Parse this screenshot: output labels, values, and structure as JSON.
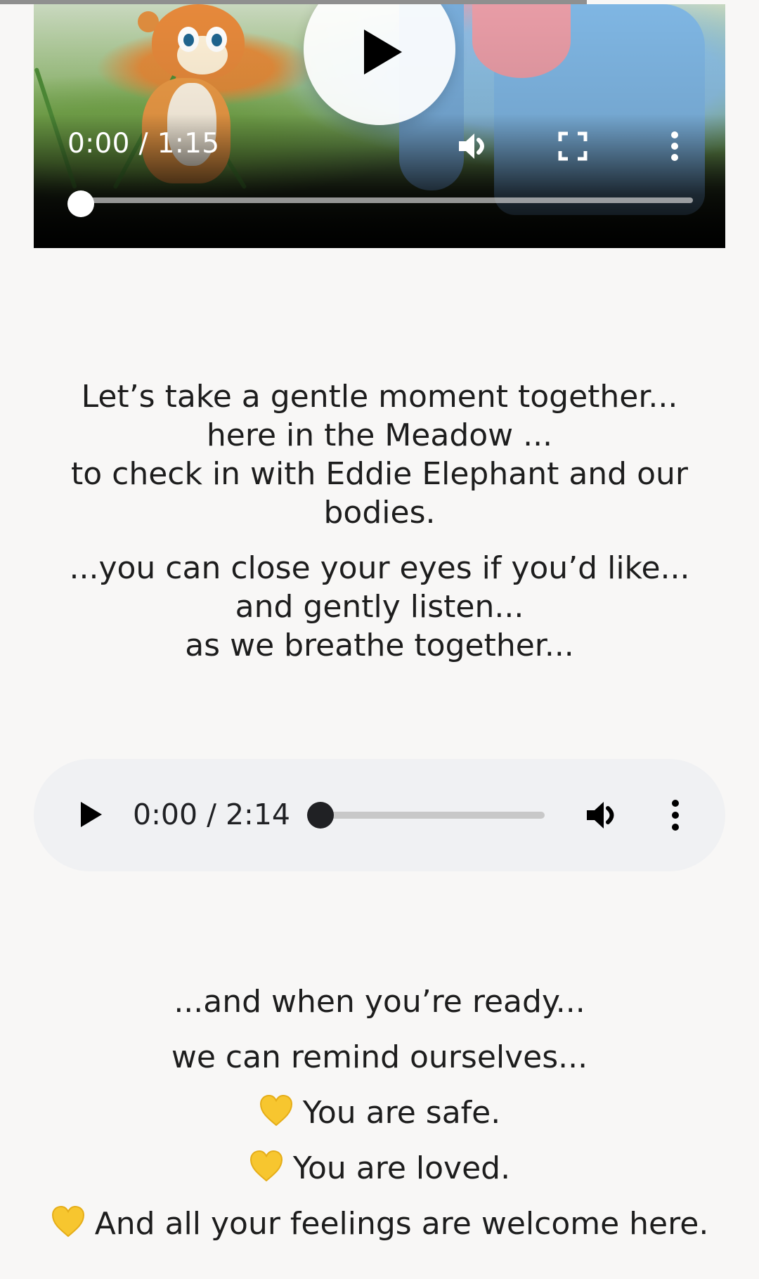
{
  "video": {
    "time": "0:00 / 1:15",
    "progress": 0
  },
  "intro": {
    "line1": "Let’s take a gentle moment together...",
    "line2": "here in the Meadow ...",
    "line3": "to check in with Eddie Elephant and our",
    "line4": "bodies.",
    "line5": "...you can close your eyes if you’d like...",
    "line6": "and gently listen...",
    "line7": "as we breathe together..."
  },
  "audio": {
    "time": "0:00 / 2:14",
    "progress": 0
  },
  "closing": {
    "line1": "...and when you’re ready...",
    "line2": "we can remind ourselves...",
    "affirmations": [
      "You are safe.",
      "You are loved.",
      "And all your feelings are welcome here."
    ]
  },
  "colors": {
    "heart": "#f7c62f",
    "page_background": "#f8f7f6",
    "audio_background": "#f0f1f3"
  },
  "icons": {
    "video_play": "play-icon",
    "volume": "volume-icon",
    "fullscreen": "fullscreen-icon",
    "more": "more-vertical-icon",
    "heart": "yellow-heart-icon"
  }
}
